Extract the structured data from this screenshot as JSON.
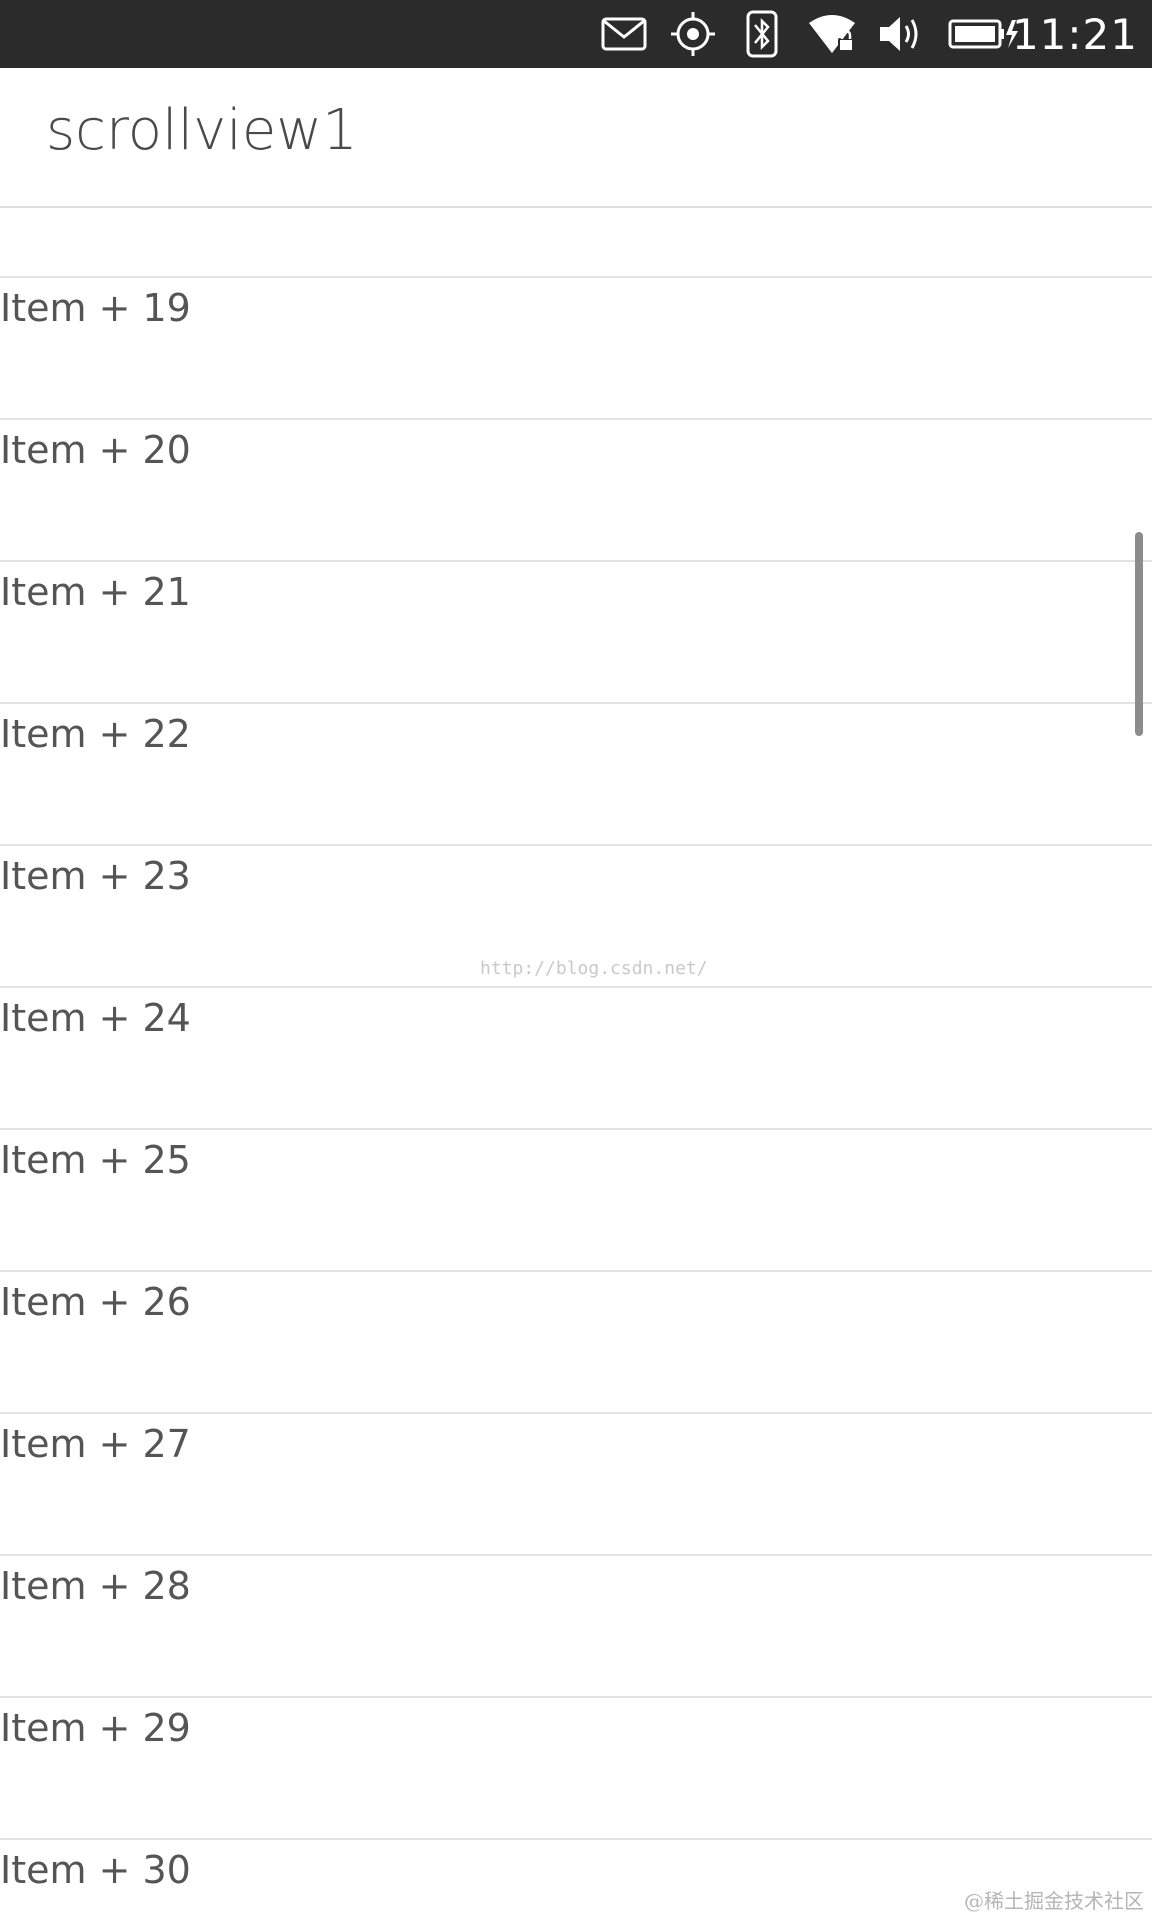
{
  "status_bar": {
    "time": "11:21",
    "icons": [
      "mail-icon",
      "location-icon",
      "bluetooth-icon",
      "wifi-lock-icon",
      "volume-icon",
      "battery-charging-icon"
    ]
  },
  "header": {
    "title": "scrollview1"
  },
  "list": {
    "items": [
      "Item + 19",
      "Item + 20",
      "Item + 21",
      "Item + 22",
      "Item + 23",
      "Item + 24",
      "Item + 25",
      "Item + 26",
      "Item + 27",
      "Item + 28",
      "Item + 29",
      "Item + 30"
    ]
  },
  "watermark": {
    "text": "http://blog.csdn.net/",
    "corner": "@稀土掘金技术社区"
  },
  "colors": {
    "status_bar_bg": "#2b2b2b",
    "text": "#555555",
    "divider": "#e2e2e2"
  }
}
